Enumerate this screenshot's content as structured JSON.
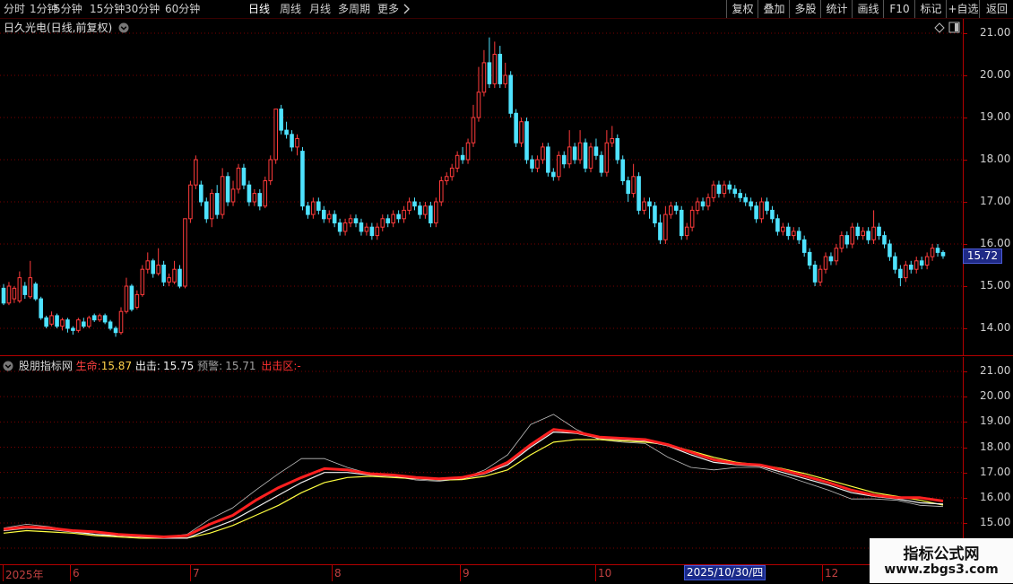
{
  "toolbar": {
    "left_items": [
      {
        "label": "分时"
      },
      {
        "label": "1分钟"
      },
      {
        "label": "5分钟"
      },
      {
        "label": "15分钟"
      },
      {
        "label": "30分钟"
      },
      {
        "label": "60分钟"
      },
      {
        "label": "日线",
        "active": true
      },
      {
        "label": "周线"
      },
      {
        "label": "月线"
      },
      {
        "label": "多周期"
      },
      {
        "label": "更多"
      }
    ],
    "right_items": [
      {
        "label": "复权"
      },
      {
        "label": "叠加"
      },
      {
        "label": "多股"
      },
      {
        "label": "统计"
      },
      {
        "label": "画线"
      },
      {
        "label": "F10"
      },
      {
        "label": "标记"
      },
      {
        "label": "+自选"
      },
      {
        "label": "返回"
      }
    ]
  },
  "main_chart": {
    "title": "日久光电(日线,前复权)",
    "price_axis": [
      "21.00",
      "20.00",
      "19.00",
      "18.00",
      "17.00",
      "16.00",
      "15.00",
      "14.00"
    ],
    "current_price": "15.72",
    "colors": {
      "up": "#ff3b3b",
      "down": "#4fe3ff",
      "grid": "#7a0000"
    }
  },
  "indicator": {
    "name": "股朋指标网",
    "life_label": "生命:",
    "life_value": "15.87",
    "out_label": "出击:",
    "out_value": "15.75",
    "warn_label": "预警:",
    "warn_value": "15.71",
    "zone_label": "出击区:",
    "zone_value": "-",
    "axis": [
      "21.00",
      "20.00",
      "19.00",
      "18.00",
      "17.00",
      "16.00",
      "15.00"
    ]
  },
  "date_axis": {
    "labels": [
      "2025年",
      "6",
      "7",
      "8",
      "9",
      "10",
      "12"
    ],
    "cursor": "2025/10/30/四"
  },
  "watermark": {
    "title": "指标公式网",
    "url": "www.zbgs3.com"
  },
  "chart_data": {
    "type": "candlestick",
    "title": "",
    "ylim": [
      13.7,
      21.3
    ],
    "candles": [
      [
        14.95,
        14.6,
        15.05,
        14.55
      ],
      [
        14.6,
        15.0,
        15.1,
        14.55
      ],
      [
        14.7,
        14.95,
        15.0,
        14.6
      ],
      [
        14.65,
        15.2,
        15.35,
        14.6
      ],
      [
        15.0,
        14.8,
        15.1,
        14.7
      ],
      [
        14.75,
        15.2,
        15.6,
        14.7
      ],
      [
        15.05,
        14.7,
        15.1,
        14.65
      ],
      [
        14.7,
        14.25,
        14.75,
        14.2
      ],
      [
        14.25,
        14.05,
        14.3,
        14.0
      ],
      [
        14.1,
        14.3,
        14.4,
        14.05
      ],
      [
        14.3,
        14.05,
        14.35,
        14.0
      ],
      [
        14.05,
        14.2,
        14.25,
        13.95
      ],
      [
        14.2,
        14.0,
        14.25,
        13.9
      ],
      [
        14.0,
        13.95,
        14.05,
        13.85
      ],
      [
        13.95,
        14.2,
        14.25,
        13.9
      ],
      [
        14.15,
        14.05,
        14.25,
        14.0
      ],
      [
        14.05,
        14.25,
        14.3,
        14.0
      ],
      [
        14.3,
        14.2,
        14.35,
        14.15
      ],
      [
        14.2,
        14.3,
        14.35,
        14.15
      ],
      [
        14.3,
        14.15,
        14.35,
        14.1
      ],
      [
        14.15,
        14.0,
        14.2,
        13.95
      ],
      [
        14.0,
        13.9,
        14.05,
        13.8
      ],
      [
        13.9,
        14.4,
        14.5,
        13.85
      ],
      [
        14.4,
        15.0,
        15.2,
        14.35
      ],
      [
        15.0,
        14.45,
        15.05,
        14.4
      ],
      [
        14.5,
        14.8,
        14.9,
        14.45
      ],
      [
        14.8,
        15.4,
        15.5,
        14.75
      ],
      [
        15.4,
        15.6,
        15.8,
        15.3
      ],
      [
        15.6,
        15.3,
        15.65,
        15.2
      ],
      [
        15.3,
        15.5,
        15.9,
        15.25
      ],
      [
        15.5,
        15.1,
        15.6,
        15.0
      ],
      [
        15.1,
        15.2,
        15.3,
        15.0
      ],
      [
        15.1,
        15.4,
        15.6,
        15.05
      ],
      [
        15.4,
        15.0,
        15.5,
        14.95
      ],
      [
        15.0,
        16.6,
        16.6,
        14.95
      ],
      [
        16.6,
        17.4,
        17.5,
        16.5
      ],
      [
        17.4,
        18.0,
        18.1,
        17.3
      ],
      [
        17.4,
        17.0,
        17.5,
        16.9
      ],
      [
        17.0,
        16.6,
        17.1,
        16.5
      ],
      [
        16.6,
        17.2,
        17.3,
        16.4
      ],
      [
        17.2,
        16.7,
        17.4,
        16.6
      ],
      [
        16.7,
        17.6,
        17.8,
        16.6
      ],
      [
        17.6,
        17.0,
        17.7,
        16.9
      ],
      [
        17.0,
        17.3,
        17.5,
        16.9
      ],
      [
        17.3,
        17.8,
        17.9,
        17.2
      ],
      [
        17.8,
        17.4,
        17.9,
        17.3
      ],
      [
        17.4,
        17.0,
        17.5,
        16.9
      ],
      [
        17.0,
        17.2,
        17.3,
        16.9
      ],
      [
        17.2,
        16.9,
        17.3,
        16.8
      ],
      [
        16.9,
        17.5,
        17.6,
        16.85
      ],
      [
        17.5,
        18.0,
        18.1,
        17.4
      ],
      [
        18.0,
        19.2,
        19.2,
        17.9
      ],
      [
        19.2,
        18.7,
        19.3,
        18.6
      ],
      [
        18.7,
        18.6,
        18.9,
        18.5
      ],
      [
        18.6,
        18.3,
        18.7,
        18.2
      ],
      [
        18.3,
        18.5,
        18.6,
        18.1
      ],
      [
        18.2,
        16.9,
        18.3,
        16.8
      ],
      [
        16.9,
        16.7,
        17.0,
        16.6
      ],
      [
        16.7,
        17.0,
        17.1,
        16.6
      ],
      [
        17.0,
        16.8,
        17.1,
        16.7
      ],
      [
        16.8,
        16.6,
        16.9,
        16.5
      ],
      [
        16.6,
        16.7,
        16.8,
        16.5
      ],
      [
        16.7,
        16.5,
        16.8,
        16.4
      ],
      [
        16.5,
        16.3,
        16.6,
        16.2
      ],
      [
        16.3,
        16.5,
        16.6,
        16.2
      ],
      [
        16.5,
        16.6,
        16.7,
        16.4
      ],
      [
        16.6,
        16.5,
        16.7,
        16.4
      ],
      [
        16.5,
        16.3,
        16.6,
        16.2
      ],
      [
        16.3,
        16.4,
        16.5,
        16.2
      ],
      [
        16.4,
        16.2,
        16.5,
        16.1
      ],
      [
        16.2,
        16.4,
        16.5,
        16.1
      ],
      [
        16.4,
        16.6,
        16.7,
        16.3
      ],
      [
        16.6,
        16.5,
        16.7,
        16.4
      ],
      [
        16.5,
        16.7,
        16.8,
        16.4
      ],
      [
        16.7,
        16.6,
        16.8,
        16.5
      ],
      [
        16.6,
        16.8,
        16.9,
        16.5
      ],
      [
        16.8,
        17.0,
        17.1,
        16.7
      ],
      [
        17.0,
        16.9,
        17.1,
        16.8
      ],
      [
        16.9,
        16.7,
        17.0,
        16.6
      ],
      [
        16.7,
        16.9,
        17.0,
        16.6
      ],
      [
        16.9,
        16.5,
        17.0,
        16.4
      ],
      [
        16.5,
        17.0,
        17.1,
        16.4
      ],
      [
        17.0,
        17.5,
        17.6,
        16.9
      ],
      [
        17.5,
        17.6,
        17.7,
        17.4
      ],
      [
        17.6,
        17.8,
        17.9,
        17.5
      ],
      [
        17.8,
        18.1,
        18.2,
        17.7
      ],
      [
        18.1,
        18.0,
        18.3,
        17.9
      ],
      [
        18.0,
        18.4,
        18.5,
        17.9
      ],
      [
        18.4,
        19.0,
        19.3,
        18.3
      ],
      [
        19.0,
        19.6,
        20.2,
        18.9
      ],
      [
        19.6,
        20.3,
        20.6,
        19.5
      ],
      [
        20.3,
        19.8,
        20.9,
        19.7
      ],
      [
        19.8,
        20.5,
        20.8,
        19.7
      ],
      [
        20.5,
        19.8,
        20.7,
        19.7
      ],
      [
        19.8,
        20.0,
        20.3,
        19.7
      ],
      [
        20.0,
        19.1,
        20.1,
        19.0
      ],
      [
        19.1,
        18.4,
        19.2,
        18.3
      ],
      [
        18.4,
        18.9,
        19.0,
        18.3
      ],
      [
        18.9,
        18.0,
        19.0,
        17.9
      ],
      [
        18.0,
        17.8,
        18.1,
        17.7
      ],
      [
        17.8,
        18.0,
        18.1,
        17.7
      ],
      [
        18.0,
        18.3,
        18.4,
        17.9
      ],
      [
        18.3,
        17.7,
        18.4,
        17.6
      ],
      [
        17.7,
        17.6,
        17.8,
        17.5
      ],
      [
        17.6,
        18.1,
        18.2,
        17.5
      ],
      [
        18.1,
        17.9,
        18.2,
        17.8
      ],
      [
        17.9,
        18.3,
        18.7,
        17.8
      ],
      [
        18.3,
        18.0,
        18.4,
        17.9
      ],
      [
        18.0,
        18.4,
        18.7,
        17.9
      ],
      [
        18.4,
        17.8,
        18.5,
        17.7
      ],
      [
        17.8,
        18.3,
        18.4,
        17.7
      ],
      [
        18.3,
        18.1,
        18.5,
        18.0
      ],
      [
        18.1,
        17.7,
        18.2,
        17.6
      ],
      [
        17.7,
        18.4,
        18.7,
        17.6
      ],
      [
        18.4,
        18.5,
        18.8,
        18.3
      ],
      [
        18.5,
        18.0,
        18.6,
        17.9
      ],
      [
        18.0,
        17.5,
        18.1,
        17.4
      ],
      [
        17.5,
        17.2,
        17.6,
        17.0
      ],
      [
        17.2,
        17.6,
        17.9,
        17.1
      ],
      [
        17.6,
        16.8,
        17.7,
        16.7
      ],
      [
        16.8,
        17.0,
        17.1,
        16.7
      ],
      [
        17.0,
        16.9,
        17.1,
        16.6
      ],
      [
        16.9,
        16.5,
        17.0,
        16.4
      ],
      [
        16.5,
        16.1,
        16.7,
        16.0
      ],
      [
        16.1,
        16.7,
        16.9,
        16.0
      ],
      [
        16.7,
        16.9,
        17.0,
        16.6
      ],
      [
        16.9,
        16.8,
        17.0,
        16.7
      ],
      [
        16.8,
        16.2,
        16.9,
        16.1
      ],
      [
        16.2,
        16.4,
        16.5,
        16.1
      ],
      [
        16.4,
        16.8,
        16.9,
        16.3
      ],
      [
        16.8,
        17.0,
        17.1,
        16.7
      ],
      [
        17.0,
        16.9,
        17.1,
        16.8
      ],
      [
        16.9,
        17.1,
        17.2,
        16.8
      ],
      [
        17.1,
        17.4,
        17.5,
        17.0
      ],
      [
        17.4,
        17.2,
        17.5,
        17.1
      ],
      [
        17.2,
        17.4,
        17.5,
        17.1
      ],
      [
        17.4,
        17.3,
        17.5,
        17.2
      ],
      [
        17.3,
        17.2,
        17.4,
        17.1
      ],
      [
        17.2,
        17.1,
        17.3,
        17.0
      ],
      [
        17.1,
        17.0,
        17.2,
        16.9
      ],
      [
        17.0,
        16.9,
        17.1,
        16.8
      ],
      [
        16.9,
        16.6,
        17.0,
        16.5
      ],
      [
        16.6,
        17.0,
        17.1,
        16.5
      ],
      [
        17.0,
        16.8,
        17.1,
        16.7
      ],
      [
        16.8,
        16.6,
        16.9,
        16.5
      ],
      [
        16.6,
        16.3,
        16.7,
        16.2
      ],
      [
        16.3,
        16.4,
        16.5,
        16.2
      ],
      [
        16.4,
        16.2,
        16.5,
        16.1
      ],
      [
        16.2,
        16.3,
        16.4,
        16.1
      ],
      [
        16.3,
        16.1,
        16.4,
        16.0
      ],
      [
        16.1,
        15.8,
        16.2,
        15.7
      ],
      [
        15.8,
        15.5,
        15.9,
        15.4
      ],
      [
        15.5,
        15.1,
        15.6,
        15.0
      ],
      [
        15.1,
        15.4,
        15.5,
        15.0
      ],
      [
        15.4,
        15.7,
        15.8,
        15.3
      ],
      [
        15.7,
        15.6,
        15.8,
        15.5
      ],
      [
        15.6,
        15.9,
        16.0,
        15.5
      ],
      [
        15.9,
        16.2,
        16.3,
        15.8
      ],
      [
        16.2,
        16.0,
        16.3,
        15.9
      ],
      [
        16.0,
        16.4,
        16.5,
        15.9
      ],
      [
        16.4,
        16.2,
        16.5,
        16.1
      ],
      [
        16.2,
        16.3,
        16.4,
        16.1
      ],
      [
        16.3,
        16.1,
        16.4,
        16.0
      ],
      [
        16.1,
        16.4,
        16.8,
        16.0
      ],
      [
        16.4,
        16.2,
        16.5,
        16.1
      ],
      [
        16.2,
        16.0,
        16.3,
        15.9
      ],
      [
        16.0,
        15.7,
        16.1,
        15.6
      ],
      [
        15.7,
        15.4,
        15.8,
        15.3
      ],
      [
        15.4,
        15.2,
        15.5,
        15.0
      ],
      [
        15.2,
        15.5,
        15.6,
        15.1
      ],
      [
        15.5,
        15.4,
        15.6,
        15.3
      ],
      [
        15.4,
        15.6,
        15.7,
        15.3
      ],
      [
        15.6,
        15.5,
        15.7,
        15.4
      ],
      [
        15.5,
        15.7,
        15.8,
        15.4
      ],
      [
        15.7,
        15.9,
        16.0,
        15.6
      ],
      [
        15.9,
        15.8,
        16.0,
        15.7
      ],
      [
        15.8,
        15.72,
        15.85,
        15.65
      ]
    ],
    "series": [
      {
        "name": "生命",
        "color": "#ff2020",
        "values": [
          14.75,
          14.85,
          14.8,
          14.7,
          14.65,
          14.55,
          14.5,
          14.45,
          14.5,
          14.95,
          15.3,
          15.9,
          16.4,
          16.8,
          17.15,
          17.1,
          16.95,
          16.9,
          16.8,
          16.75,
          16.8,
          17.0,
          17.4,
          18.1,
          18.7,
          18.6,
          18.4,
          18.35,
          18.3,
          18.1,
          17.8,
          17.5,
          17.35,
          17.3,
          17.1,
          16.85,
          16.6,
          16.3,
          16.1,
          16.0,
          16.0,
          15.87
        ]
      },
      {
        "name": "出击",
        "color": "#f0f0f0",
        "values": [
          14.7,
          14.8,
          14.75,
          14.65,
          14.55,
          14.5,
          14.45,
          14.4,
          14.4,
          14.75,
          15.1,
          15.6,
          16.1,
          16.6,
          17.0,
          17.0,
          16.9,
          16.85,
          16.75,
          16.7,
          16.75,
          16.95,
          17.3,
          18.0,
          18.6,
          18.55,
          18.35,
          18.3,
          18.25,
          18.05,
          17.7,
          17.4,
          17.3,
          17.25,
          17.0,
          16.75,
          16.5,
          16.2,
          16.05,
          15.95,
          15.8,
          15.75
        ]
      },
      {
        "name": "预警",
        "color": "#ffff40",
        "values": [
          14.6,
          14.7,
          14.65,
          14.6,
          14.5,
          14.45,
          14.4,
          14.4,
          14.4,
          14.6,
          14.9,
          15.3,
          15.7,
          16.2,
          16.6,
          16.8,
          16.85,
          16.8,
          16.75,
          16.7,
          16.72,
          16.85,
          17.1,
          17.7,
          18.2,
          18.3,
          18.3,
          18.25,
          18.2,
          18.1,
          17.85,
          17.6,
          17.4,
          17.3,
          17.15,
          16.95,
          16.7,
          16.45,
          16.2,
          16.05,
          15.9,
          15.71
        ]
      },
      {
        "name": "envelope",
        "color": "#bfbfbf",
        "values": [
          14.8,
          14.95,
          14.85,
          14.7,
          14.55,
          14.45,
          14.4,
          14.45,
          14.55,
          15.15,
          15.6,
          16.3,
          16.95,
          17.55,
          17.55,
          17.2,
          16.95,
          16.85,
          16.7,
          16.65,
          16.75,
          17.1,
          17.7,
          18.9,
          19.3,
          18.7,
          18.3,
          18.2,
          18.15,
          17.6,
          17.2,
          17.1,
          17.2,
          17.2,
          16.9,
          16.6,
          16.3,
          15.95,
          15.95,
          15.9,
          15.7,
          15.65
        ]
      }
    ]
  }
}
